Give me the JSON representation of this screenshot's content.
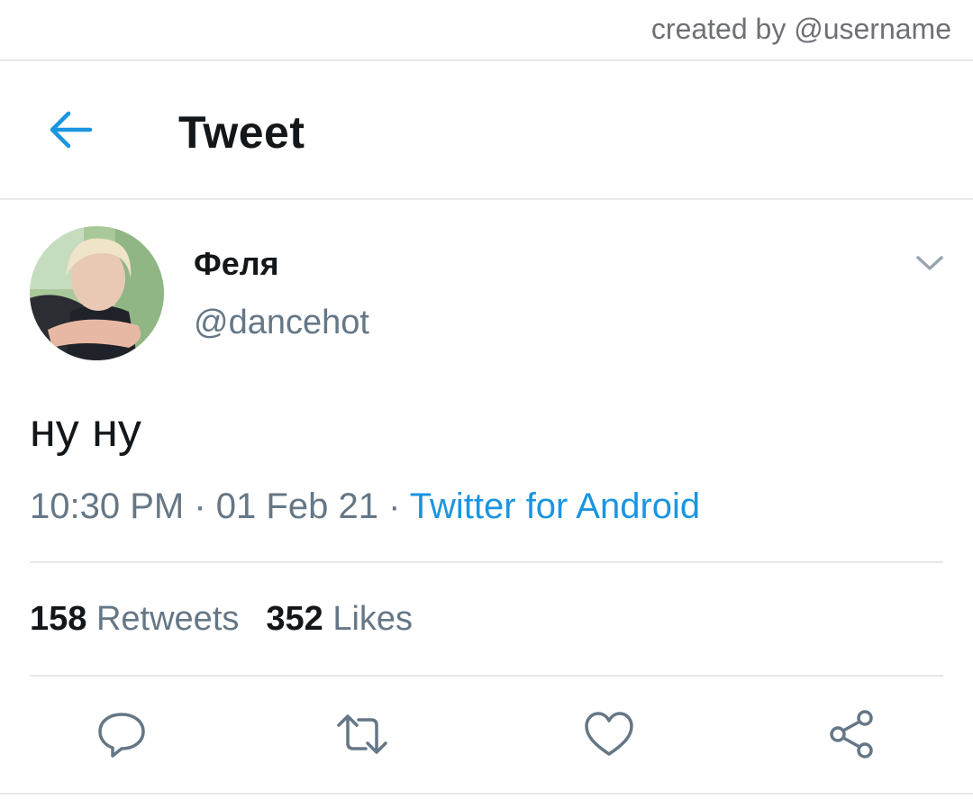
{
  "credit": "created by @username",
  "header": {
    "title": "Tweet",
    "back_icon": "arrow-left-icon"
  },
  "tweet": {
    "author": {
      "display_name": "Феля",
      "handle": "@dancehot"
    },
    "text": "ну ну",
    "time": "10:30 PM",
    "separator": "·",
    "date": "01 Feb 21",
    "source": "Twitter for Android",
    "stats": {
      "retweets_count": "158",
      "retweets_label": "Retweets",
      "likes_count": "352",
      "likes_label": "Likes"
    }
  },
  "actions": [
    "reply-icon",
    "retweet-icon",
    "like-icon",
    "share-icon"
  ],
  "colors": {
    "accent": "#1b95e0",
    "secondary_text": "#657786",
    "primary_text": "#14171a",
    "divider": "#e6e8ea"
  }
}
